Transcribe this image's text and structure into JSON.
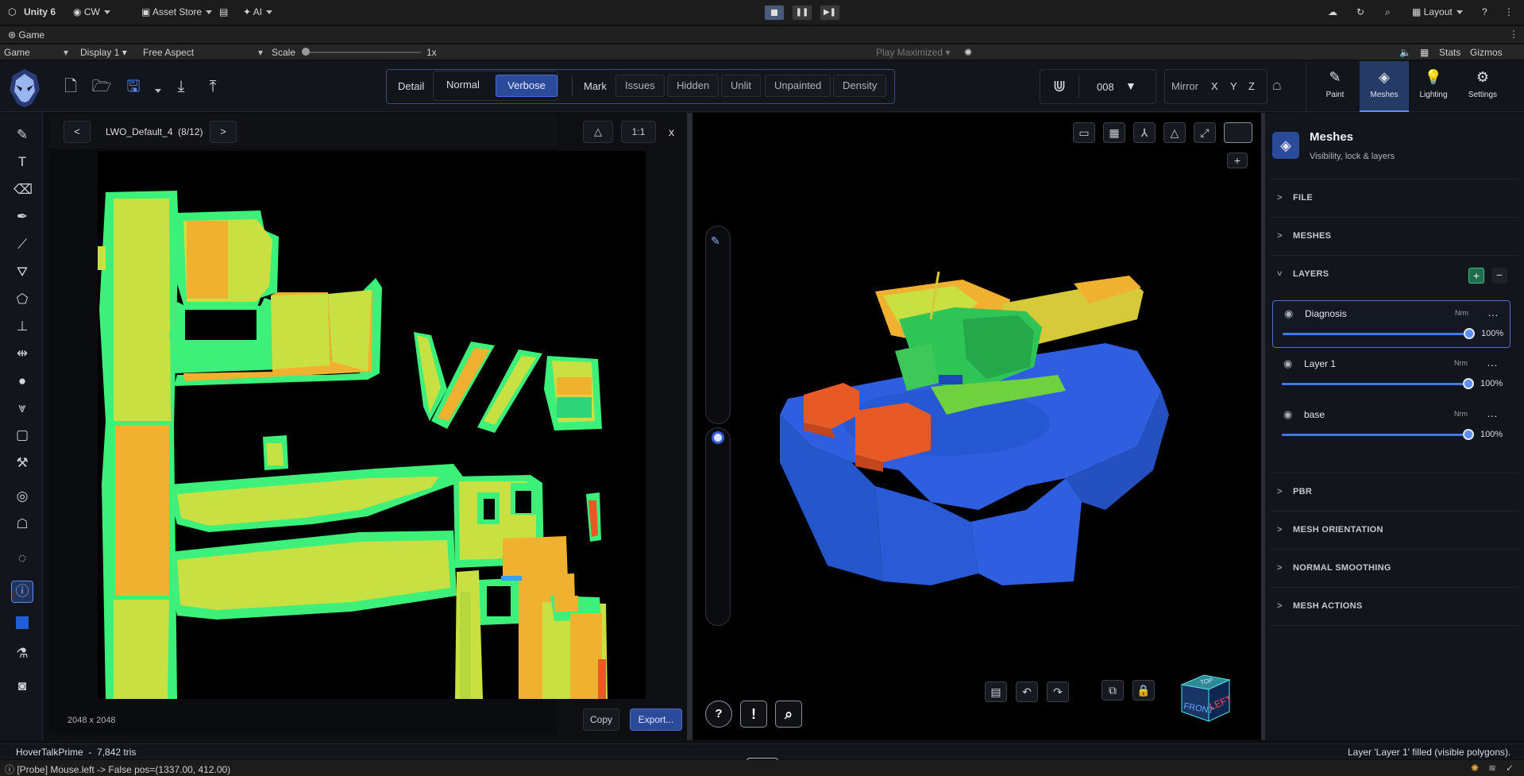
{
  "unity_bar": {
    "version": "Unity 6",
    "account": "CW",
    "asset_store": "Asset Store",
    "ai": "AI",
    "layout": "Layout"
  },
  "game_tab": {
    "label": "Game"
  },
  "game_bar": {
    "view": "Game",
    "display": "Display 1",
    "aspect": "Free Aspect",
    "scale_label": "Scale",
    "scale_value": "1x",
    "play_mode": "Play Maximized",
    "stats": "Stats",
    "gizmos": "Gizmos"
  },
  "toolbar": {
    "detail_label": "Detail",
    "detail_options": [
      "Normal",
      "Verbose"
    ],
    "detail_selected": "Verbose",
    "mark_label": "Mark",
    "mark_options": [
      "Issues",
      "Hidden",
      "Unlit",
      "Unpainted",
      "Density"
    ],
    "brush_number": "008",
    "mirror_label": "Mirror",
    "mirror_axes": [
      "X",
      "Y",
      "Z"
    ]
  },
  "right_tabs": [
    {
      "label": "Paint",
      "icon": "brush-icon"
    },
    {
      "label": "Meshes",
      "icon": "layers-icon"
    },
    {
      "label": "Lighting",
      "icon": "bulb-icon"
    },
    {
      "label": "Settings",
      "icon": "gear-icon"
    }
  ],
  "uv_panel": {
    "prev": "<",
    "next": ">",
    "texture_name": "LWO_Default_4",
    "texture_index": "(8/12)",
    "zoom": "1:1",
    "close": "x",
    "resolution": "2048 x 2048",
    "copy": "Copy",
    "export": "Export..."
  },
  "meshes_panel": {
    "title": "Meshes",
    "subtitle": "Visibility, lock & layers",
    "sections_top": [
      "FILE",
      "MESHES"
    ],
    "layers_title": "LAYERS",
    "layers": [
      {
        "name": "Diagnosis",
        "blend": "Nrm",
        "opacity": "100%",
        "selected": true
      },
      {
        "name": "Layer 1",
        "blend": "Nrm",
        "opacity": "100%",
        "selected": false
      },
      {
        "name": "base",
        "blend": "Nrm",
        "opacity": "100%",
        "selected": false
      }
    ],
    "sections_bottom": [
      "PBR",
      "MESH ORIENTATION",
      "NORMAL SMOOTHING",
      "MESH ACTIONS"
    ]
  },
  "view_cube": {
    "top": "TOP",
    "front": "FRONT",
    "left": "LEFT"
  },
  "status": {
    "mesh_name": "HoverTalkPrime",
    "tris": "7,842 tris",
    "message": "Layer 'Layer 1' filled (visible polygons).",
    "console": "[Probe] Mouse.left -> False  pos=(1337.00, 412.00)"
  },
  "colors": {
    "accent": "#2b4a9a",
    "uv_green": "#3cf07a",
    "uv_yellow": "#c8e041",
    "uv_orange": "#f0b030",
    "mesh_blue": "#2f5fe0",
    "mesh_orange": "#e85a25"
  }
}
